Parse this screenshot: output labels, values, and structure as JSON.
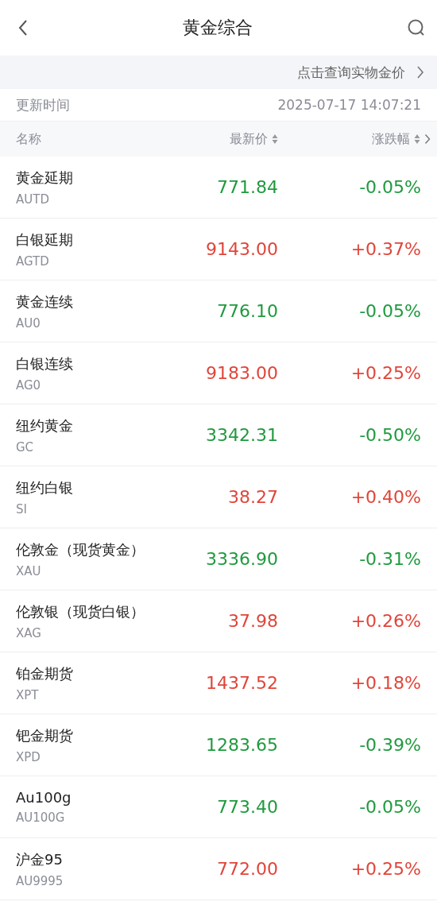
{
  "header": {
    "title": "黄金综合"
  },
  "banner": {
    "text": "点击查询实物金价"
  },
  "update": {
    "label": "更新时间",
    "time": "2025-07-17 14:07:21"
  },
  "columns": [
    "名称",
    "最新价",
    "涨跌幅"
  ],
  "rows": [
    {
      "name": "黄金延期",
      "code": "AUTD",
      "price": "771.84",
      "change": "-0.05%",
      "color": "#1f9a3e"
    },
    {
      "name": "白银延期",
      "code": "AGTD",
      "price": "9143.00",
      "change": "+0.37%",
      "color": "#e0453a"
    },
    {
      "name": "黄金连续",
      "code": "AU0",
      "price": "776.10",
      "change": "-0.05%",
      "color": "#1f9a3e"
    },
    {
      "name": "白银连续",
      "code": "AG0",
      "price": "9183.00",
      "change": "+0.25%",
      "color": "#e0453a"
    },
    {
      "name": "纽约黄金",
      "code": "GC",
      "price": "3342.31",
      "change": "-0.50%",
      "color": "#1f9a3e"
    },
    {
      "name": "纽约白银",
      "code": "SI",
      "price": "38.27",
      "change": "+0.40%",
      "color": "#e0453a"
    },
    {
      "name": "伦敦金（现货黄金）",
      "code": "XAU",
      "price": "3336.90",
      "change": "-0.31%",
      "color": "#1f9a3e"
    },
    {
      "name": "伦敦银（现货白银）",
      "code": "XAG",
      "price": "37.98",
      "change": "+0.26%",
      "color": "#e0453a"
    },
    {
      "name": "铂金期货",
      "code": "XPT",
      "price": "1437.52",
      "change": "+0.18%",
      "color": "#e0453a"
    },
    {
      "name": "钯金期货",
      "code": "XPD",
      "price": "1283.65",
      "change": "-0.39%",
      "color": "#1f9a3e"
    },
    {
      "name": "Au100g",
      "code": "AU100G",
      "price": "773.40",
      "change": "-0.05%",
      "color": "#1f9a3e"
    },
    {
      "name": "沪金95",
      "code": "AU9995",
      "price": "772.00",
      "change": "+0.25%",
      "color": "#e0453a"
    }
  ]
}
